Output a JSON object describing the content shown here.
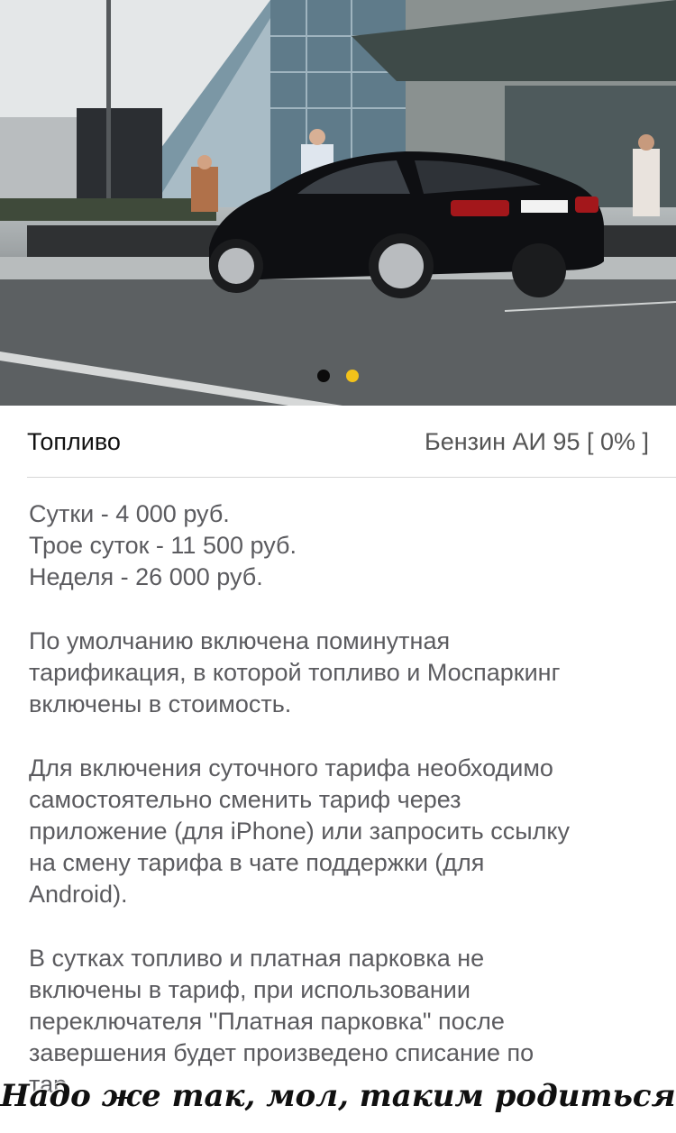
{
  "gallery": {
    "photo_icon": "car-photo",
    "dots": [
      {
        "active": true,
        "color": "#0b0b0b"
      },
      {
        "active": false,
        "color": "#f3c21a"
      }
    ]
  },
  "fuel": {
    "label": "Топливо",
    "value": "Бензин АИ 95 [ 0% ]"
  },
  "tariffs": {
    "day": "Сутки - 4 000 руб.",
    "three_days": "Трое суток - 11 500 руб.",
    "week": "Неделя - 26 000 руб."
  },
  "paragraphs": {
    "p1_line1": "По умолчанию включена поминутная",
    "p1_line2": "тарификация, в которой топливо и Моспаркинг",
    "p1_line3": "включены в стоимость.",
    "p2_line1": "Для включения суточного тарифа необходимо",
    "p2_line2": "самостоятельно сменить тариф через",
    "p2_line3": "приложение (для iPhone) или запросить ссылку",
    "p2_line4": "на смену тарифа в чате поддержки (для",
    "p2_line5": "Android).",
    "p3_line1": "В сутках топливо и платная парковка не",
    "p3_line2": "включены в тариф, при использовании",
    "p3_line3": "переключателя \"Платная парковка\" после",
    "p3_line4": "завершения будет произведено списание по",
    "p3_line5": "тар"
  },
  "watermark": "Надо же так, мол, таким родиться"
}
